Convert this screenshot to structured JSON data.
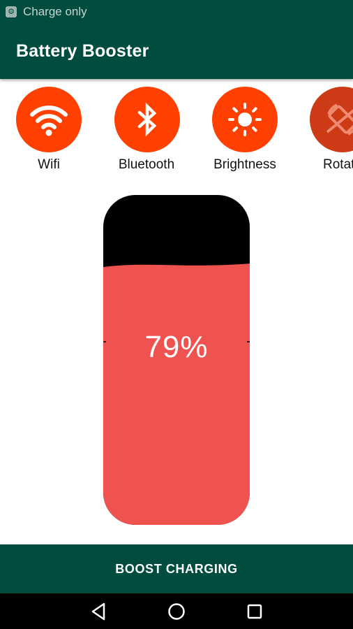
{
  "status_bar": {
    "icon": "settings-icon",
    "text": "Charge only"
  },
  "app_bar": {
    "title": "Battery Booster"
  },
  "toggles": [
    {
      "label": "Wifi",
      "icon": "wifi-icon"
    },
    {
      "label": "Bluetooth",
      "icon": "bluetooth-icon"
    },
    {
      "label": "Brightness",
      "icon": "brightness-icon"
    },
    {
      "label": "Rotate",
      "icon": "rotate-icon"
    }
  ],
  "battery": {
    "level_percent": 79,
    "label": "79%"
  },
  "boost": {
    "label": "BOOST CHARGING"
  },
  "nav": {
    "back": "back-icon",
    "home": "home-icon",
    "recents": "recents-icon"
  },
  "colors": {
    "primary": "#004d40",
    "toggle_accent": "#ff4000",
    "battery_fill": "#ef5350",
    "battery_empty": "#000000"
  }
}
